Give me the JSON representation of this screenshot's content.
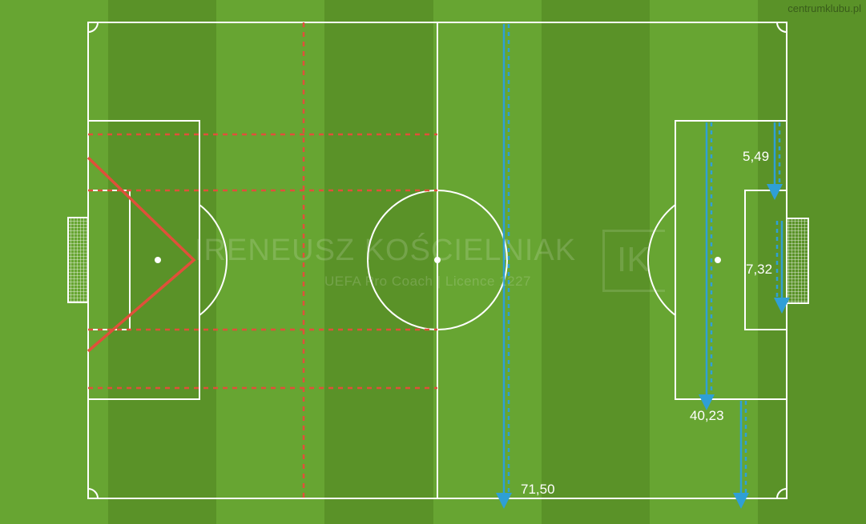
{
  "brand": "centrumklubu.pl",
  "watermark": {
    "name": "IRENEUSZ KOŚCIELNIAK",
    "subtitle": "UEFA Pro Coach   |   Licence 1227",
    "logo": "IK"
  },
  "measurements": {
    "goal_area_depth": "5,49",
    "goal_width": "7,32",
    "penalty_area_width": "40,23",
    "pitch_width": "71,50"
  },
  "colors": {
    "grass_light": "#67a532",
    "grass_dark": "#5a9228",
    "lines": "#ffffff",
    "red_zones": "#e0503a",
    "blue_arrows": "#2f9fd6"
  }
}
